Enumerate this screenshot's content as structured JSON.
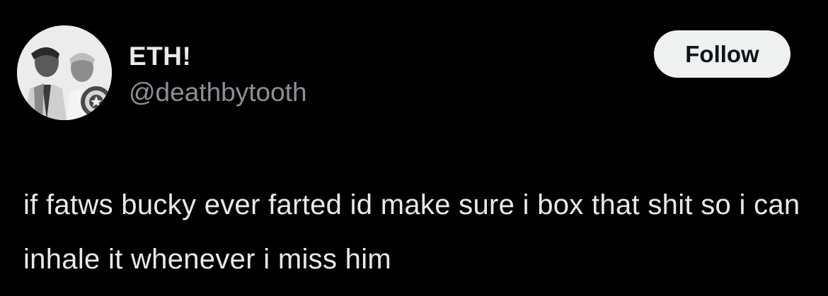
{
  "author": {
    "display_name": "ETH!",
    "handle": "@deathbytooth",
    "avatar_icon": "avatar-photo-icon"
  },
  "follow_button": {
    "label": "Follow"
  },
  "tweet": {
    "text": "if fatws bucky ever farted id make sure i box that shit so i can inhale it whenever i miss him"
  },
  "colors": {
    "background": "#000000",
    "primary_text": "#e7e9ea",
    "secondary_text": "#8b9096",
    "button_bg": "#eff1f1",
    "button_text": "#0f1419"
  }
}
